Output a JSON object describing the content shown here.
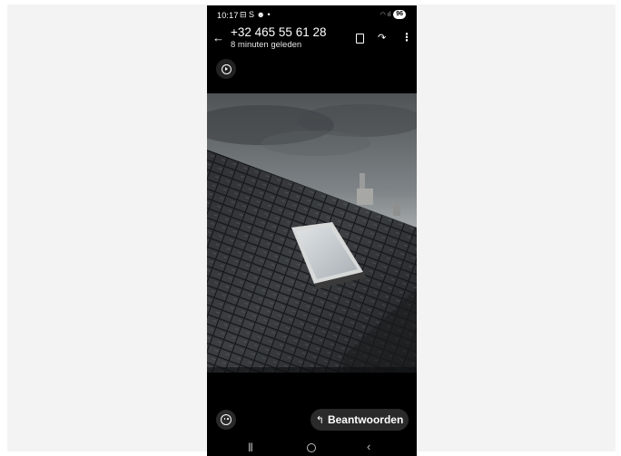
{
  "status_bar": {
    "time": "10:17",
    "left_icons": "⊟ S ☻ •",
    "battery": "96"
  },
  "header": {
    "contact": "+32 465 55 61 28",
    "last_seen": "8 minuten geleden"
  },
  "media": {
    "icons": [
      "back-arrow-icon",
      "bookmark-icon",
      "share-icon",
      "more-icon",
      "play-icon"
    ]
  },
  "bottom": {
    "reply_label": "Beantwoorden",
    "icons": [
      "emoji-icon",
      "reply-arrow-icon"
    ]
  },
  "colors": {
    "background": "#000000",
    "button": "#2a2a2a",
    "text": "#ffffff"
  }
}
